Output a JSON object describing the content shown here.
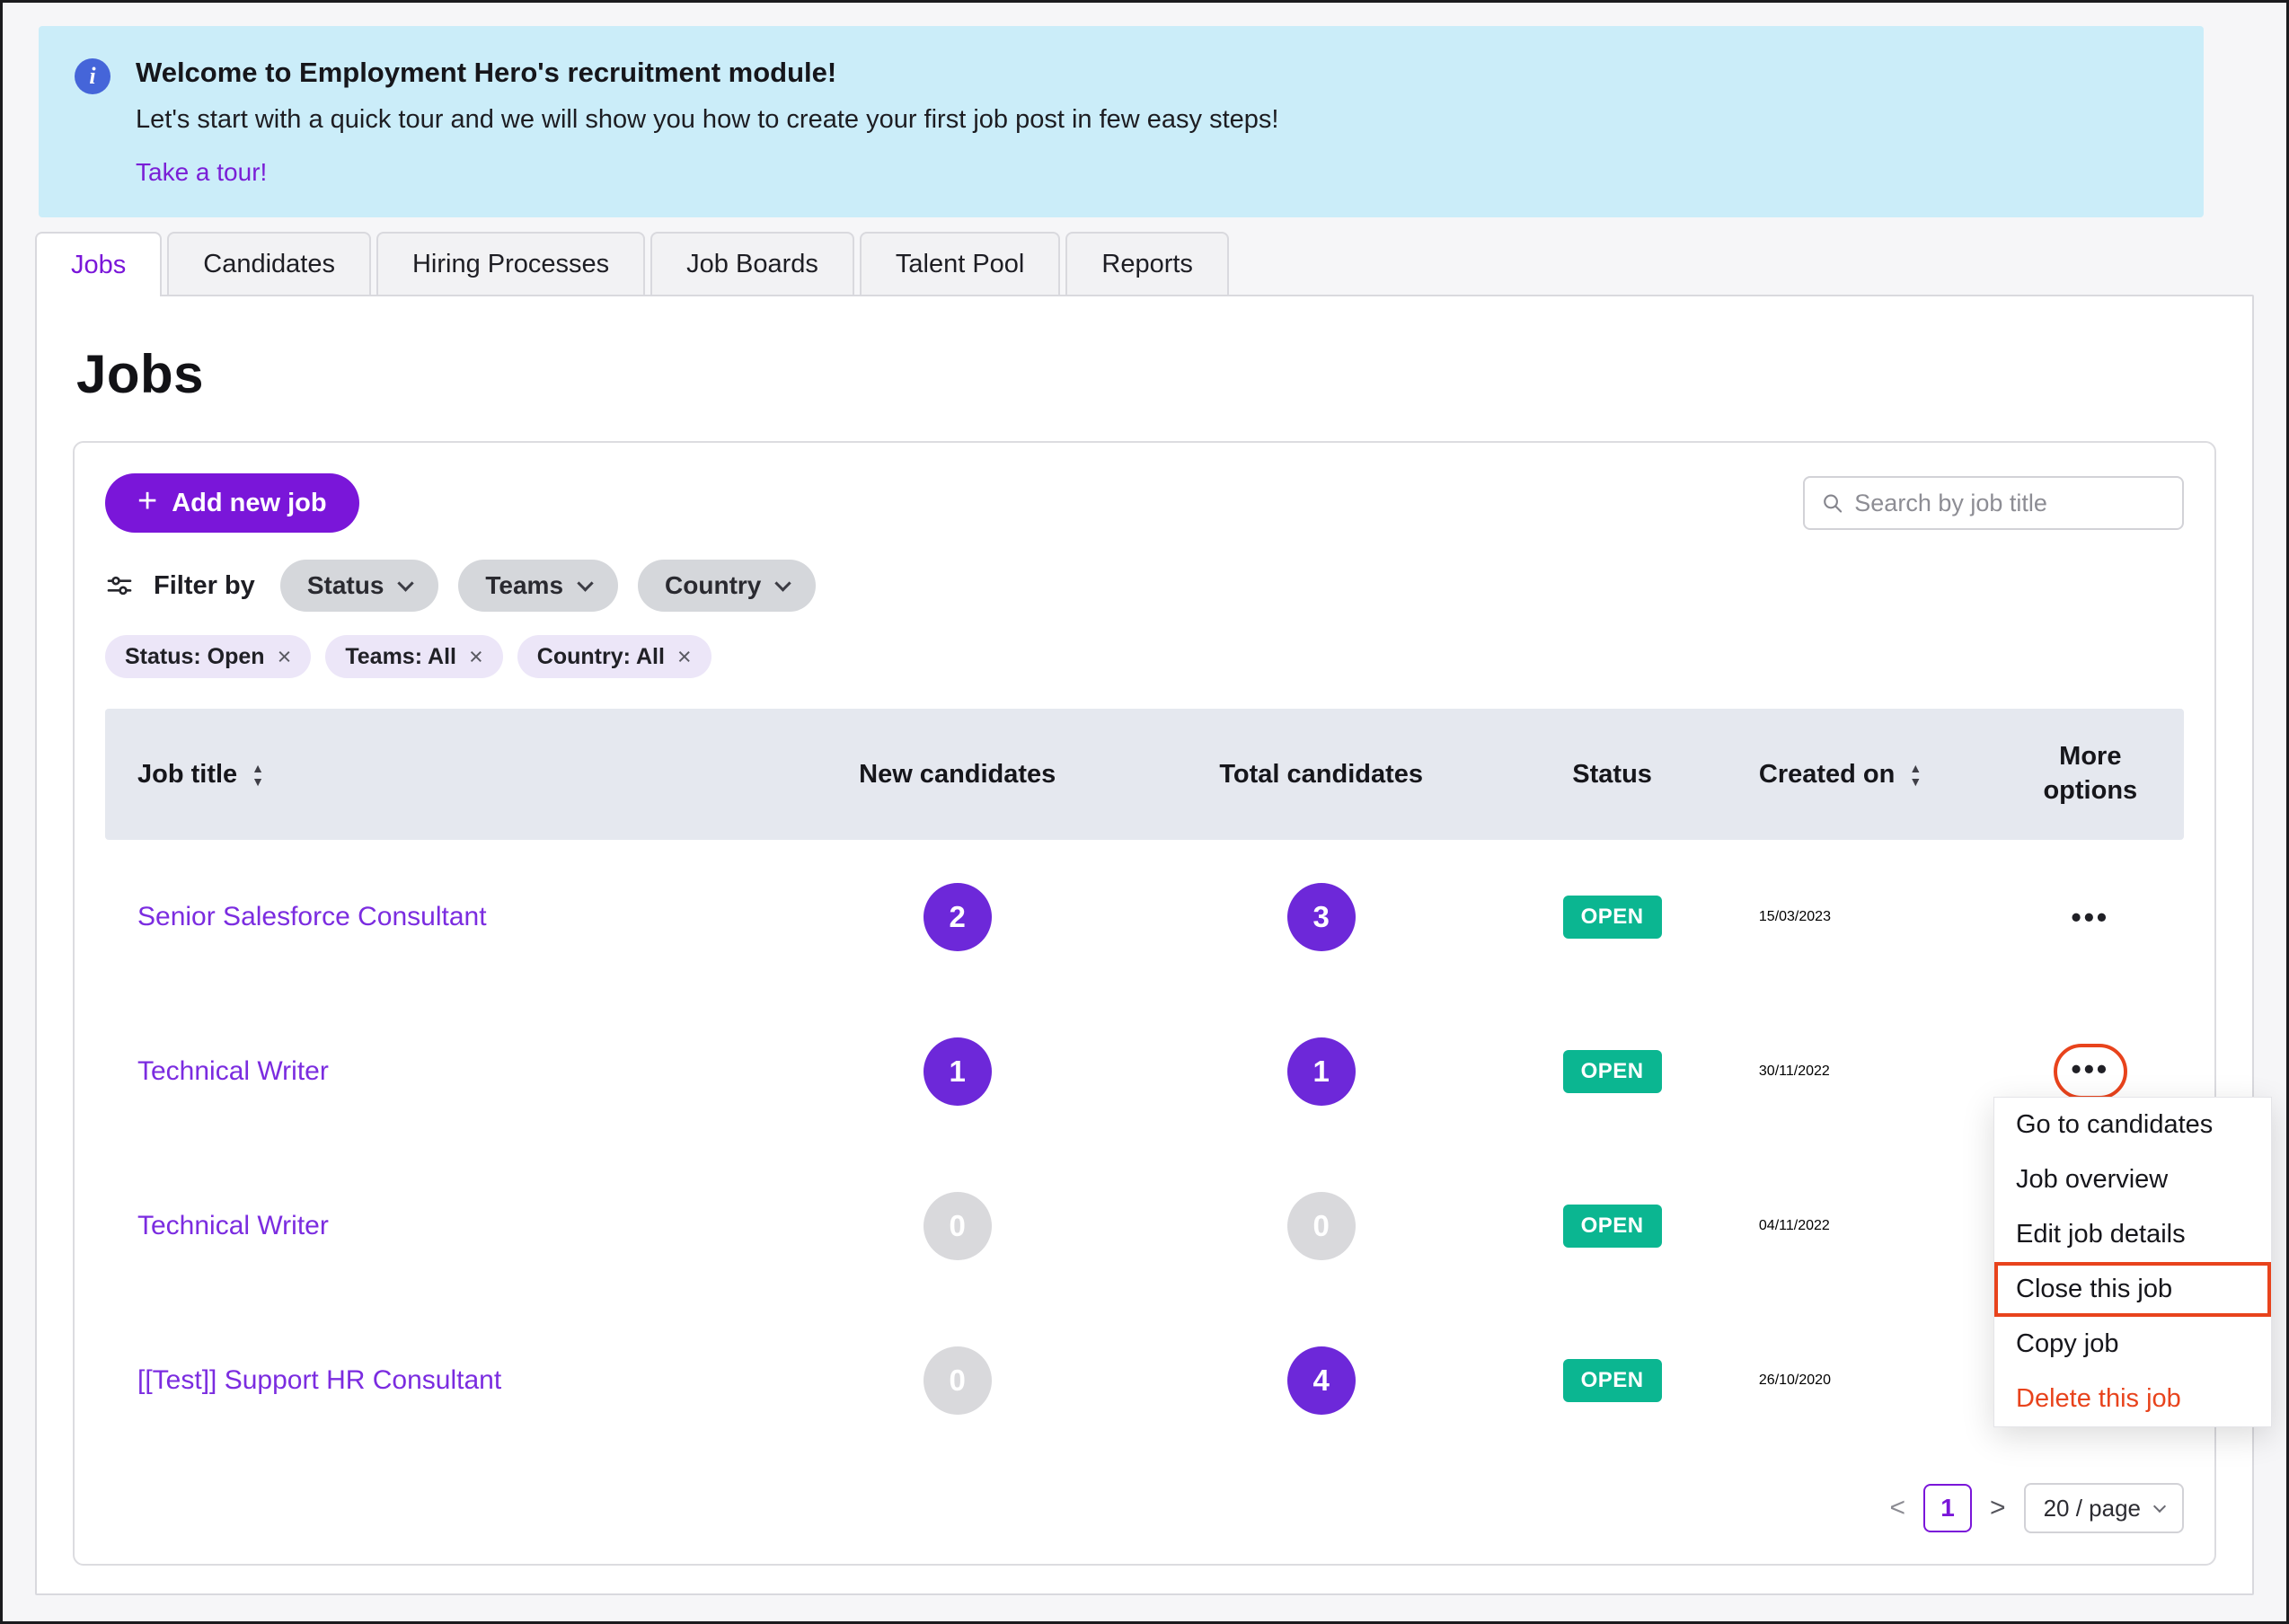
{
  "colors": {
    "accent_purple": "#7A16D9",
    "link_purple": "#7B2CE0",
    "badge_teal": "#0BB691",
    "annotation_red": "#E8431C",
    "banner_blue": "#CBEDF9"
  },
  "banner": {
    "title": "Welcome to Employment Hero's recruitment module!",
    "subtitle": "Let's start with a quick tour and we will show you how to create your first job post in few easy steps!",
    "link_label": "Take a tour!"
  },
  "tabs": [
    {
      "label": "Jobs"
    },
    {
      "label": "Candidates"
    },
    {
      "label": "Hiring Processes"
    },
    {
      "label": "Job Boards"
    },
    {
      "label": "Talent Pool"
    },
    {
      "label": "Reports"
    }
  ],
  "page": {
    "title": "Jobs"
  },
  "toolbar": {
    "add_job_label": "Add new job",
    "search_placeholder": "Search by job title",
    "filter_by_label": "Filter by",
    "filter_buttons": [
      {
        "label": "Status"
      },
      {
        "label": "Teams"
      },
      {
        "label": "Country"
      }
    ],
    "filter_chips": [
      {
        "label": "Status: Open"
      },
      {
        "label": "Teams: All"
      },
      {
        "label": "Country: All"
      }
    ]
  },
  "table": {
    "headers": {
      "job_title": "Job title",
      "new_candidates": "New candidates",
      "total_candidates": "Total candidates",
      "status": "Status",
      "created_on": "Created on",
      "more_options": "More options"
    },
    "rows": [
      {
        "title": "Senior Salesforce Consultant",
        "new_candidates": "2",
        "total_candidates": "3",
        "status": "OPEN",
        "created_on": "15/03/2023"
      },
      {
        "title": "Technical Writer",
        "new_candidates": "1",
        "total_candidates": "1",
        "status": "OPEN",
        "created_on": "30/11/2022"
      },
      {
        "title": "Technical Writer",
        "new_candidates": "0",
        "total_candidates": "0",
        "status": "OPEN",
        "created_on": "04/11/2022"
      },
      {
        "title": "[[Test]] Support HR Consultant",
        "new_candidates": "0",
        "total_candidates": "4",
        "status": "OPEN",
        "created_on": "26/10/2020"
      }
    ]
  },
  "context_menu": {
    "items": [
      {
        "label": "Go to candidates"
      },
      {
        "label": "Job overview"
      },
      {
        "label": "Edit job details"
      },
      {
        "label": "Close this job"
      },
      {
        "label": "Copy job"
      },
      {
        "label": "Delete this job"
      }
    ]
  },
  "pagination": {
    "prev": "<",
    "page": "1",
    "next": ">",
    "page_size": "20 / page"
  },
  "icons": {
    "info": "i",
    "plus": "+",
    "close": "×",
    "more": "•••",
    "sort_up": "▲",
    "sort_down": "▼"
  }
}
